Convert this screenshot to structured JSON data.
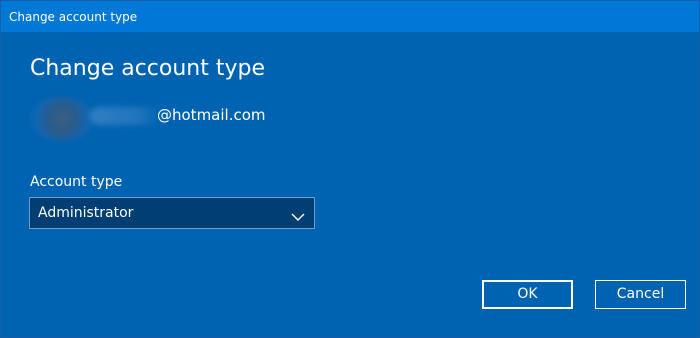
{
  "window": {
    "title": "Change account type"
  },
  "dialog": {
    "heading": "Change account type",
    "account": {
      "email_suffix": "@hotmail.com"
    },
    "account_type": {
      "label": "Account type",
      "selected": "Administrator"
    },
    "buttons": {
      "ok_label": "OK",
      "cancel_label": "Cancel"
    }
  },
  "colors": {
    "background": "#0063b1",
    "titlebar": "#0078d7",
    "dropdown": "#003e74",
    "text": "#ffffff"
  },
  "icons": {
    "dropdown": "chevron-down-icon",
    "avatar": "blurred-avatar"
  }
}
